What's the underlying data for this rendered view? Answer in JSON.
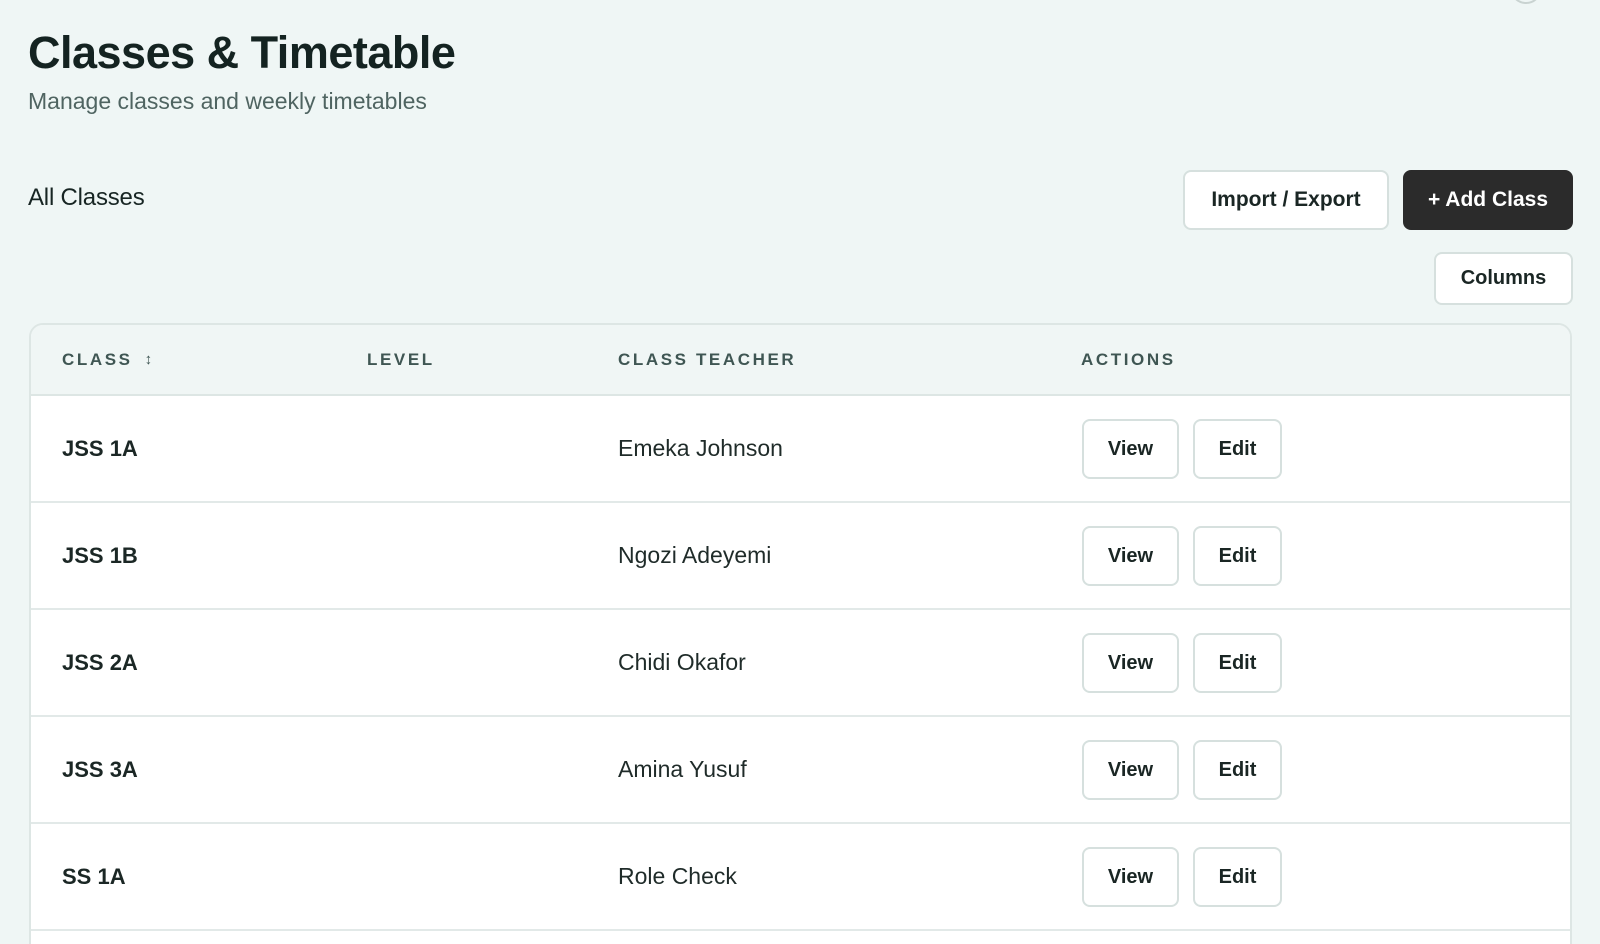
{
  "header": {
    "title": "Classes & Timetable",
    "subtitle": "Manage classes and weekly timetables"
  },
  "toolbar": {
    "section_title": "All Classes",
    "import_export_label": "Import / Export",
    "add_class_label": "+ Add Class",
    "columns_label": "Columns"
  },
  "table": {
    "columns": {
      "class": "CLASS",
      "level": "LEVEL",
      "teacher": "CLASS TEACHER",
      "actions": "ACTIONS"
    },
    "sort_icon": "↕",
    "rows": [
      {
        "class": "JSS 1A",
        "level": "",
        "teacher": "Emeka Johnson",
        "view": "View",
        "edit": "Edit"
      },
      {
        "class": "JSS 1B",
        "level": "",
        "teacher": "Ngozi Adeyemi",
        "view": "View",
        "edit": "Edit"
      },
      {
        "class": "JSS 2A",
        "level": "",
        "teacher": "Chidi Okafor",
        "view": "View",
        "edit": "Edit"
      },
      {
        "class": "JSS 3A",
        "level": "",
        "teacher": "Amina Yusuf",
        "view": "View",
        "edit": "Edit"
      },
      {
        "class": "SS 1A",
        "level": "",
        "teacher": "Role Check",
        "view": "View",
        "edit": "Edit"
      }
    ]
  }
}
